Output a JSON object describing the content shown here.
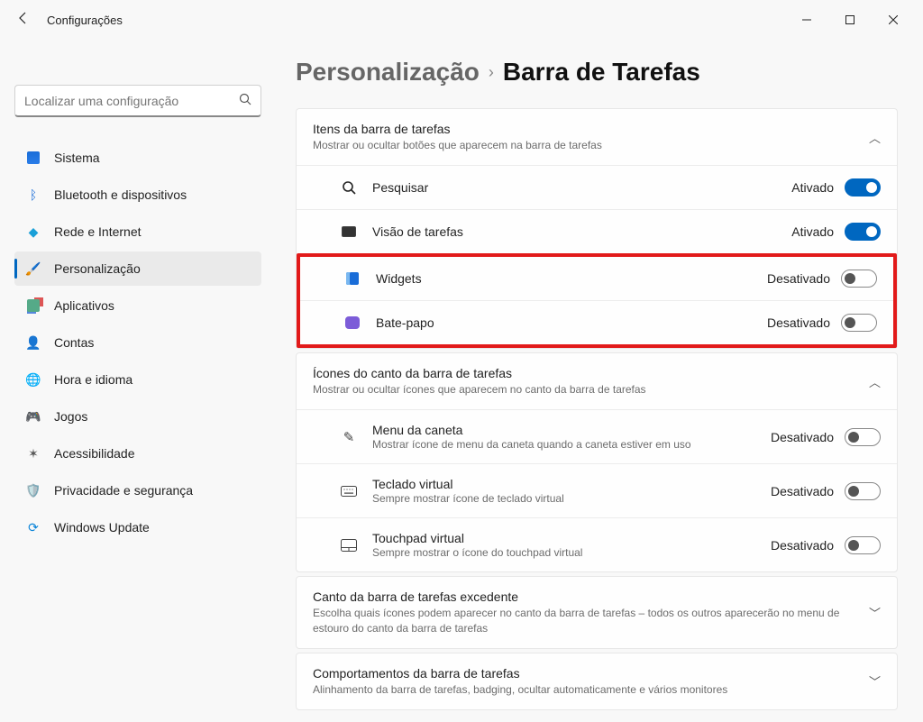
{
  "app": {
    "title": "Configurações"
  },
  "search": {
    "placeholder": "Localizar uma configuração"
  },
  "nav": {
    "items": [
      {
        "label": "Sistema",
        "name": "sidebar-item-system"
      },
      {
        "label": "Bluetooth e dispositivos",
        "name": "sidebar-item-bluetooth"
      },
      {
        "label": "Rede e Internet",
        "name": "sidebar-item-network"
      },
      {
        "label": "Personalização",
        "name": "sidebar-item-personalization"
      },
      {
        "label": "Aplicativos",
        "name": "sidebar-item-apps"
      },
      {
        "label": "Contas",
        "name": "sidebar-item-accounts"
      },
      {
        "label": "Hora e idioma",
        "name": "sidebar-item-time"
      },
      {
        "label": "Jogos",
        "name": "sidebar-item-gaming"
      },
      {
        "label": "Acessibilidade",
        "name": "sidebar-item-accessibility"
      },
      {
        "label": "Privacidade e segurança",
        "name": "sidebar-item-privacy"
      },
      {
        "label": "Windows Update",
        "name": "sidebar-item-update"
      }
    ]
  },
  "breadcrumb": {
    "crumb1": "Personalização",
    "crumb2": "Barra de Tarefas"
  },
  "sections": {
    "taskbar_items": {
      "title": "Itens da barra de tarefas",
      "subtitle": "Mostrar ou ocultar botões que aparecem na barra de tarefas",
      "rows": [
        {
          "label": "Pesquisar",
          "state": "Ativado",
          "on": true
        },
        {
          "label": "Visão de tarefas",
          "state": "Ativado",
          "on": true
        },
        {
          "label": "Widgets",
          "state": "Desativado",
          "on": false
        },
        {
          "label": "Bate-papo",
          "state": "Desativado",
          "on": false
        }
      ]
    },
    "corner_icons": {
      "title": "Ícones do canto da barra de tarefas",
      "subtitle": "Mostrar ou ocultar ícones que aparecem no canto da barra de tarefas",
      "rows": [
        {
          "label": "Menu da caneta",
          "sub": "Mostrar ícone de menu da caneta quando a caneta estiver em uso",
          "state": "Desativado",
          "on": false
        },
        {
          "label": "Teclado virtual",
          "sub": "Sempre mostrar ícone de teclado virtual",
          "state": "Desativado",
          "on": false
        },
        {
          "label": "Touchpad virtual",
          "sub": "Sempre mostrar o ícone do touchpad virtual",
          "state": "Desativado",
          "on": false
        }
      ]
    },
    "overflow": {
      "title": "Canto da barra de tarefas excedente",
      "subtitle": "Escolha quais ícones podem aparecer no canto da barra de tarefas – todos os outros aparecerão no menu de estouro do canto da barra de tarefas"
    },
    "behaviors": {
      "title": "Comportamentos da barra de tarefas",
      "subtitle": "Alinhamento da barra de tarefas, badging, ocultar automaticamente e vários monitores"
    }
  }
}
